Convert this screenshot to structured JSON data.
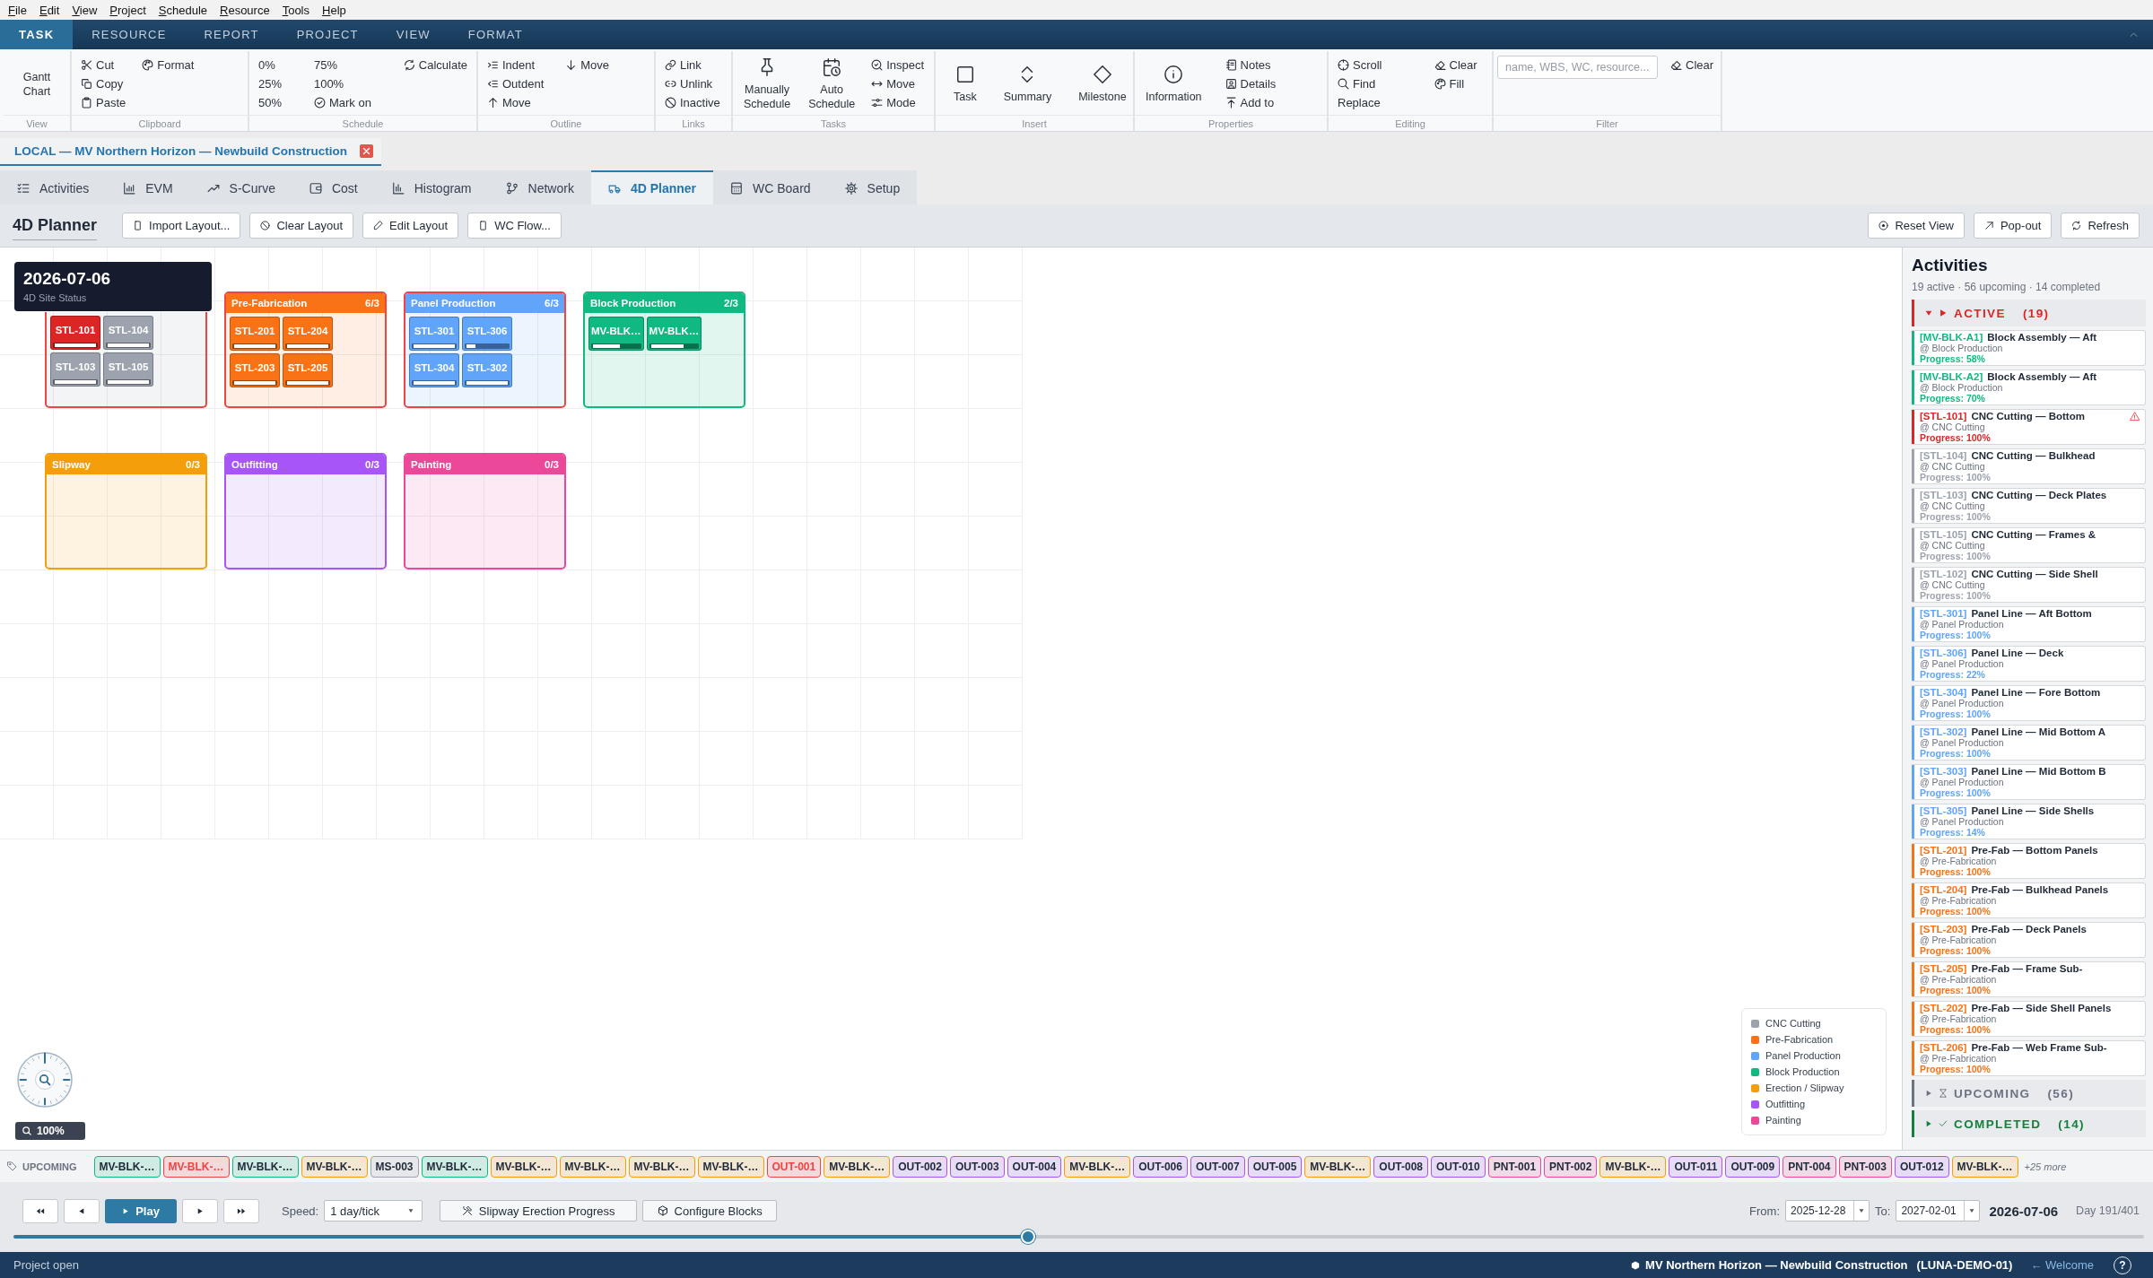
{
  "menu_bar": [
    "File",
    "Edit",
    "View",
    "Project",
    "Schedule",
    "Resource",
    "Tools",
    "Help"
  ],
  "ribbon": {
    "tabs": [
      {
        "label": "TASK",
        "selected": true
      },
      {
        "label": "RESOURCE",
        "selected": false
      },
      {
        "label": "REPORT",
        "selected": false
      },
      {
        "label": "PROJECT",
        "selected": false
      },
      {
        "label": "VIEW",
        "selected": false
      },
      {
        "label": "FORMAT",
        "selected": false
      }
    ],
    "groups": [
      {
        "label": "View",
        "items": [
          {
            "kind": "large",
            "label": "Gantt Chart"
          }
        ]
      },
      {
        "label": "Clipboard",
        "items": [
          {
            "kind": "small",
            "label": "Cut"
          },
          {
            "kind": "small",
            "label": "Copy"
          },
          {
            "kind": "small",
            "label": "Paste"
          },
          {
            "kind": "small",
            "label": "Format"
          }
        ]
      },
      {
        "label": "Schedule",
        "items": [
          {
            "kind": "small",
            "label": "0%"
          },
          {
            "kind": "small",
            "label": "25%"
          },
          {
            "kind": "small",
            "label": "50%"
          },
          {
            "kind": "small",
            "label": "75%"
          },
          {
            "kind": "small",
            "label": "100%"
          },
          {
            "kind": "small",
            "label": "Mark on"
          },
          {
            "kind": "small",
            "label": "Calculate"
          }
        ]
      },
      {
        "label": "Outline",
        "items": [
          {
            "kind": "small",
            "label": "Indent"
          },
          {
            "kind": "small",
            "label": "Outdent"
          },
          {
            "kind": "small",
            "label": "Move"
          },
          {
            "kind": "small",
            "label": "Move"
          }
        ]
      },
      {
        "label": "Links",
        "items": [
          {
            "kind": "small",
            "label": "Link"
          },
          {
            "kind": "small",
            "label": "Unlink"
          },
          {
            "kind": "small",
            "label": "Inactive"
          }
        ]
      },
      {
        "label": "Tasks",
        "items": [
          {
            "kind": "large",
            "label": "Manually Schedule"
          },
          {
            "kind": "large",
            "label": "Auto Schedule"
          },
          {
            "kind": "small",
            "label": "Inspect"
          },
          {
            "kind": "small",
            "label": "Move"
          },
          {
            "kind": "small",
            "label": "Mode"
          }
        ]
      },
      {
        "label": "Insert",
        "items": [
          {
            "kind": "large",
            "label": "Task"
          },
          {
            "kind": "large",
            "label": "Summary"
          },
          {
            "kind": "large",
            "label": "Milestone"
          }
        ]
      },
      {
        "label": "Properties",
        "items": [
          {
            "kind": "large",
            "label": "Information"
          },
          {
            "kind": "small",
            "label": "Notes"
          },
          {
            "kind": "small",
            "label": "Details"
          },
          {
            "kind": "small",
            "label": "Add to"
          }
        ]
      },
      {
        "label": "Editing",
        "items": [
          {
            "kind": "small",
            "label": "Scroll"
          },
          {
            "kind": "small",
            "label": "Find"
          },
          {
            "kind": "small",
            "label": "Replace"
          },
          {
            "kind": "small",
            "label": "Clear"
          },
          {
            "kind": "small",
            "label": "Fill"
          }
        ]
      },
      {
        "label": "Filter",
        "items": [
          {
            "kind": "field",
            "placeholder": "name, WBS, WC, resource..."
          },
          {
            "kind": "small",
            "label": "Clear"
          }
        ]
      }
    ]
  },
  "document_tab": {
    "title": "LOCAL — MV Northern Horizon — Newbuild Construction"
  },
  "view_tabs": [
    {
      "label": "Activities",
      "selected": false
    },
    {
      "label": "EVM",
      "selected": false
    },
    {
      "label": "S-Curve",
      "selected": false
    },
    {
      "label": "Cost",
      "selected": false
    },
    {
      "label": "Histogram",
      "selected": false
    },
    {
      "label": "Network",
      "selected": false
    },
    {
      "label": "4D Planner",
      "selected": true
    },
    {
      "label": "WC Board",
      "selected": false
    },
    {
      "label": "Setup",
      "selected": false
    }
  ],
  "toolbar": {
    "title": "4D Planner",
    "left_buttons": [
      "Import Layout...",
      "Clear Layout",
      "Edit Layout",
      "WC Flow..."
    ],
    "right_buttons": [
      "Reset View",
      "Pop-out",
      "Refresh"
    ]
  },
  "canvas": {
    "date_overlay": {
      "date": "2026-07-06",
      "subtitle": "4D Site Status"
    },
    "zones": [
      {
        "color": "#9ca3af",
        "over_capacity": true,
        "tiles": [
          {
            "label": "STL-101",
            "alert": true,
            "level": 1
          },
          {
            "label": "STL-104",
            "alert": false,
            "level": 1
          },
          {
            "label": "STL-103",
            "alert": false,
            "level": 1
          },
          {
            "label": "STL-105",
            "alert": false,
            "level": 1
          }
        ]
      },
      {
        "name": "Pre-Fabrication",
        "count": "6/3",
        "color": "#f97316",
        "over_capacity": true,
        "tiles": [
          {
            "label": "STL-201",
            "alert": false,
            "level": 1
          },
          {
            "label": "STL-204",
            "alert": false,
            "level": 1
          },
          {
            "label": "STL-203",
            "alert": false,
            "level": 1
          },
          {
            "label": "STL-205",
            "alert": false,
            "level": 1
          }
        ]
      },
      {
        "name": "Panel Production",
        "count": "6/3",
        "color": "#60a5fa",
        "over_capacity": true,
        "tiles": [
          {
            "label": "STL-301",
            "alert": false,
            "level": 1
          },
          {
            "label": "STL-306",
            "alert": false,
            "level": 0.22
          },
          {
            "label": "STL-304",
            "alert": false,
            "level": 1
          },
          {
            "label": "STL-302",
            "alert": false,
            "level": 1
          }
        ]
      },
      {
        "name": "Block Production",
        "count": "2/3",
        "color": "#10b981",
        "over_capacity": false,
        "tiles": [
          {
            "label": "MV-BLK…",
            "alert": false,
            "level": 0.58
          },
          {
            "label": "MV-BLK…",
            "alert": false,
            "level": 0.7
          }
        ]
      },
      {
        "name": "Slipway",
        "count": "0/3",
        "color": "#f59e0b",
        "over_capacity": false
      },
      {
        "name": "Outfitting",
        "count": "0/3",
        "color": "#a855f7",
        "over_capacity": false
      },
      {
        "name": "Painting",
        "count": "0/3",
        "color": "#ec4899",
        "over_capacity": false
      }
    ],
    "zoom_level": "100%",
    "legend": [
      {
        "label": "CNC Cutting",
        "color": "#9ca3af"
      },
      {
        "label": "Pre-Fabrication",
        "color": "#f97316"
      },
      {
        "label": "Panel Production",
        "color": "#60a5fa"
      },
      {
        "label": "Block Production",
        "color": "#10b981"
      },
      {
        "label": "Erection / Slipway",
        "color": "#f59e0b"
      },
      {
        "label": "Outfitting",
        "color": "#a855f7"
      },
      {
        "label": "Painting",
        "color": "#ec4899"
      }
    ]
  },
  "activities_panel": {
    "title": "Activities",
    "summary": "19 active · 56 upcoming · 14 completed",
    "sections": [
      {
        "label": "ACTIVE",
        "count": "(19)",
        "color": "#dc2626",
        "expanded": true,
        "items": [
          {
            "id": "[MV-BLK-A1]",
            "title": "Block Assembly — Aft",
            "location": "@ Block Production",
            "progress": "Progress: 58%",
            "color": "#10b981",
            "alert": false
          },
          {
            "id": "[MV-BLK-A2]",
            "title": "Block Assembly — Aft",
            "location": "@ Block Production",
            "progress": "Progress: 70%",
            "color": "#10b981",
            "alert": false
          },
          {
            "id": "[STL-101]",
            "title": "CNC Cutting — Bottom",
            "location": "@ CNC Cutting",
            "progress": "Progress: 100%",
            "color": "#dc2626",
            "alert": true
          },
          {
            "id": "[STL-104]",
            "title": "CNC Cutting — Bulkhead",
            "location": "@ CNC Cutting",
            "progress": "Progress: 100%",
            "color": "#9ca3af",
            "alert": false
          },
          {
            "id": "[STL-103]",
            "title": "CNC Cutting — Deck Plates",
            "location": "@ CNC Cutting",
            "progress": "Progress: 100%",
            "color": "#9ca3af",
            "alert": false
          },
          {
            "id": "[STL-105]",
            "title": "CNC Cutting — Frames &",
            "location": "@ CNC Cutting",
            "progress": "Progress: 100%",
            "color": "#9ca3af",
            "alert": false
          },
          {
            "id": "[STL-102]",
            "title": "CNC Cutting — Side Shell",
            "location": "@ CNC Cutting",
            "progress": "Progress: 100%",
            "color": "#9ca3af",
            "alert": false
          },
          {
            "id": "[STL-301]",
            "title": "Panel Line — Aft Bottom",
            "location": "@ Panel Production",
            "progress": "Progress: 100%",
            "color": "#60a5fa",
            "alert": false
          },
          {
            "id": "[STL-306]",
            "title": "Panel Line — Deck",
            "location": "@ Panel Production",
            "progress": "Progress: 22%",
            "color": "#60a5fa",
            "alert": false
          },
          {
            "id": "[STL-304]",
            "title": "Panel Line — Fore Bottom",
            "location": "@ Panel Production",
            "progress": "Progress: 100%",
            "color": "#60a5fa",
            "alert": false
          },
          {
            "id": "[STL-302]",
            "title": "Panel Line — Mid Bottom A",
            "location": "@ Panel Production",
            "progress": "Progress: 100%",
            "color": "#60a5fa",
            "alert": false
          },
          {
            "id": "[STL-303]",
            "title": "Panel Line — Mid Bottom B",
            "location": "@ Panel Production",
            "progress": "Progress: 100%",
            "color": "#60a5fa",
            "alert": false
          },
          {
            "id": "[STL-305]",
            "title": "Panel Line — Side Shells",
            "location": "@ Panel Production",
            "progress": "Progress: 14%",
            "color": "#60a5fa",
            "alert": false
          },
          {
            "id": "[STL-201]",
            "title": "Pre-Fab — Bottom Panels",
            "location": "@ Pre-Fabrication",
            "progress": "Progress: 100%",
            "color": "#f97316",
            "alert": false
          },
          {
            "id": "[STL-204]",
            "title": "Pre-Fab — Bulkhead Panels",
            "location": "@ Pre-Fabrication",
            "progress": "Progress: 100%",
            "color": "#f97316",
            "alert": false
          },
          {
            "id": "[STL-203]",
            "title": "Pre-Fab — Deck Panels",
            "location": "@ Pre-Fabrication",
            "progress": "Progress: 100%",
            "color": "#f97316",
            "alert": false
          },
          {
            "id": "[STL-205]",
            "title": "Pre-Fab — Frame Sub-",
            "location": "@ Pre-Fabrication",
            "progress": "Progress: 100%",
            "color": "#f97316",
            "alert": false
          },
          {
            "id": "[STL-202]",
            "title": "Pre-Fab — Side Shell Panels",
            "location": "@ Pre-Fabrication",
            "progress": "Progress: 100%",
            "color": "#f97316",
            "alert": false
          },
          {
            "id": "[STL-206]",
            "title": "Pre-Fab — Web Frame Sub-",
            "location": "@ Pre-Fabrication",
            "progress": "Progress: 100%",
            "color": "#f97316",
            "alert": false
          }
        ]
      },
      {
        "label": "UPCOMING",
        "count": "(56)",
        "color": "#6b7280",
        "expanded": false
      },
      {
        "label": "COMPLETED",
        "count": "(14)",
        "color": "#15803d",
        "expanded": false
      }
    ]
  },
  "upcoming_strip": {
    "label": "UPCOMING",
    "chips": [
      {
        "label": "MV-BLK-…",
        "color": "#10b981",
        "alert": false
      },
      {
        "label": "MV-BLK-…",
        "color": "#ef4444",
        "alert": true
      },
      {
        "label": "MV-BLK-…",
        "color": "#10b981",
        "alert": false
      },
      {
        "label": "MV-BLK-…",
        "color": "#f59e0b",
        "alert": false
      },
      {
        "label": "MS-003",
        "color": "#9ca3af",
        "alert": false
      },
      {
        "label": "MV-BLK-…",
        "color": "#10b981",
        "alert": false
      },
      {
        "label": "MV-BLK-…",
        "color": "#f59e0b",
        "alert": false
      },
      {
        "label": "MV-BLK-…",
        "color": "#f59e0b",
        "alert": false
      },
      {
        "label": "MV-BLK-…",
        "color": "#f59e0b",
        "alert": false
      },
      {
        "label": "MV-BLK-…",
        "color": "#f59e0b",
        "alert": false
      },
      {
        "label": "OUT-001",
        "color": "#ef4444",
        "alert": true
      },
      {
        "label": "MV-BLK-…",
        "color": "#f59e0b",
        "alert": false
      },
      {
        "label": "OUT-002",
        "color": "#a855f7",
        "alert": false
      },
      {
        "label": "OUT-003",
        "color": "#a855f7",
        "alert": false
      },
      {
        "label": "OUT-004",
        "color": "#a855f7",
        "alert": false
      },
      {
        "label": "MV-BLK-…",
        "color": "#f59e0b",
        "alert": false
      },
      {
        "label": "OUT-006",
        "color": "#a855f7",
        "alert": false
      },
      {
        "label": "OUT-007",
        "color": "#a855f7",
        "alert": false
      },
      {
        "label": "OUT-005",
        "color": "#a855f7",
        "alert": false
      },
      {
        "label": "MV-BLK-…",
        "color": "#f59e0b",
        "alert": false
      },
      {
        "label": "OUT-008",
        "color": "#a855f7",
        "alert": false
      },
      {
        "label": "OUT-010",
        "color": "#a855f7",
        "alert": false
      },
      {
        "label": "PNT-001",
        "color": "#ec4899",
        "alert": false
      },
      {
        "label": "PNT-002",
        "color": "#ec4899",
        "alert": false
      },
      {
        "label": "MV-BLK-…",
        "color": "#f59e0b",
        "alert": false
      },
      {
        "label": "OUT-011",
        "color": "#a855f7",
        "alert": false
      },
      {
        "label": "OUT-009",
        "color": "#a855f7",
        "alert": false
      },
      {
        "label": "PNT-004",
        "color": "#ec4899",
        "alert": false
      },
      {
        "label": "PNT-003",
        "color": "#ec4899",
        "alert": false
      },
      {
        "label": "OUT-012",
        "color": "#a855f7",
        "alert": false
      },
      {
        "label": "MV-BLK-…",
        "color": "#f59e0b",
        "alert": false
      }
    ],
    "more": "+25 more"
  },
  "playback": {
    "play_label": "Play",
    "speed_label": "Speed:",
    "speed": "1 day/tick",
    "actions": [
      "Slipway Erection Progress",
      "Configure Blocks"
    ],
    "from_label": "From:",
    "from": "2025-12-28",
    "to_label": "To:",
    "to": "2027-02-01",
    "current_date": "2026-07-06",
    "day": "Day 191/401",
    "timeline": {
      "level": 0.476
    }
  },
  "status_bar": {
    "message": "Project open",
    "project": "MV Northern Horizon — Newbuild Construction",
    "project_code": "(LUNA-DEMO-01)",
    "link": "← Welcome",
    "help": "?"
  }
}
